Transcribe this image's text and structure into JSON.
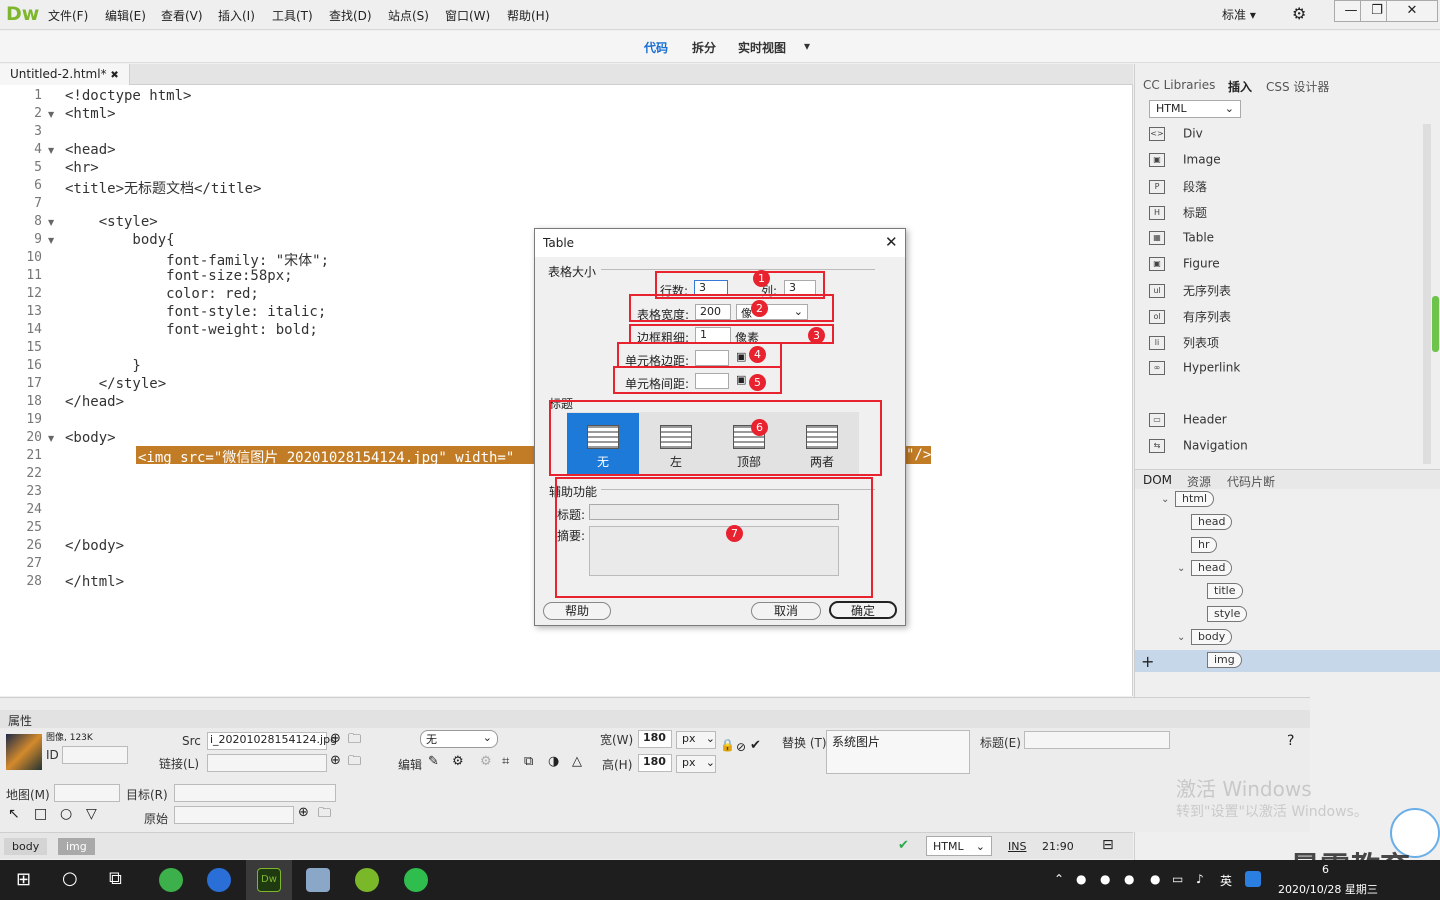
{
  "app": {
    "logo": "Dw",
    "menu": [
      "文件(F)",
      "编辑(E)",
      "查看(V)",
      "插入(I)",
      "工具(T)",
      "查找(D)",
      "站点(S)",
      "窗口(W)",
      "帮助(H)"
    ],
    "layout_select": "标准",
    "window_controls": [
      "—",
      "❐",
      "✕"
    ]
  },
  "viewbar": {
    "code": "代码",
    "split": "拆分",
    "live": "实时视图"
  },
  "document": {
    "tab_label": "Untitled-2.html*",
    "lines": [
      {
        "n": "1",
        "text": "<!doctype html>"
      },
      {
        "n": "2",
        "text": "<html>"
      },
      {
        "n": "3",
        "text": ""
      },
      {
        "n": "4",
        "text": "<head>"
      },
      {
        "n": "5",
        "text": "<hr>"
      },
      {
        "n": "6",
        "text": "<title>无标题文档</title>"
      },
      {
        "n": "7",
        "text": ""
      },
      {
        "n": "8",
        "text": "    <style>"
      },
      {
        "n": "9",
        "text": "        body{"
      },
      {
        "n": "10",
        "text": "            font-family: \"宋体\";"
      },
      {
        "n": "11",
        "text": "            font-size:58px;"
      },
      {
        "n": "12",
        "text": "            color: red;"
      },
      {
        "n": "13",
        "text": "            font-style: italic;"
      },
      {
        "n": "14",
        "text": "            font-weight: bold;"
      },
      {
        "n": "15",
        "text": ""
      },
      {
        "n": "16",
        "text": "        }"
      },
      {
        "n": "17",
        "text": "    </style>"
      },
      {
        "n": "18",
        "text": "</head>"
      },
      {
        "n": "19",
        "text": ""
      },
      {
        "n": "20",
        "text": "<body>"
      },
      {
        "n": "21",
        "text": ""
      },
      {
        "n": "22",
        "text": ""
      },
      {
        "n": "23",
        "text": ""
      },
      {
        "n": "24",
        "text": ""
      },
      {
        "n": "25",
        "text": ""
      },
      {
        "n": "26",
        "text": "</body>"
      },
      {
        "n": "27",
        "text": ""
      },
      {
        "n": "28",
        "text": "</html>"
      }
    ],
    "highlight_left": "<img src=\"微信图片_20201028154124.jpg\" width=\"",
    "highlight_right": "\"/>"
  },
  "right_panel": {
    "tabs": [
      "CC Libraries",
      "插入",
      "CSS 设计器"
    ],
    "category": "HTML",
    "insert_items": [
      {
        "icon": "div-icon",
        "glyph": "<>",
        "label": "Div"
      },
      {
        "icon": "image-icon",
        "glyph": "▣",
        "label": "Image"
      },
      {
        "icon": "paragraph-icon",
        "glyph": "P",
        "label": "段落"
      },
      {
        "icon": "heading-icon",
        "glyph": "H",
        "label": "标题"
      },
      {
        "icon": "table-icon",
        "glyph": "▦",
        "label": "Table"
      },
      {
        "icon": "figure-icon",
        "glyph": "▣",
        "label": "Figure"
      },
      {
        "icon": "ul-icon",
        "glyph": "ul",
        "label": "无序列表"
      },
      {
        "icon": "ol-icon",
        "glyph": "ol",
        "label": "有序列表"
      },
      {
        "icon": "li-icon",
        "glyph": "li",
        "label": "列表项"
      },
      {
        "icon": "hyperlink-icon",
        "glyph": "∞",
        "label": "Hyperlink"
      },
      {
        "icon": "header-icon",
        "glyph": "▭",
        "label": "Header"
      },
      {
        "icon": "navigation-icon",
        "glyph": "⇆",
        "label": "Navigation"
      }
    ],
    "dom_tabs": [
      "DOM",
      "资源",
      "代码片断"
    ],
    "dom_nodes": [
      "html",
      "head",
      "hr",
      "head",
      "title",
      "style",
      "body",
      "img"
    ]
  },
  "properties": {
    "title": "属性",
    "image_info": "图像, 123K",
    "id_label": "ID",
    "src_label": "Src",
    "src_value": "i_20201028154124.jpg",
    "link_label": "链接(L)",
    "class_value": "无",
    "edit_label": "编辑",
    "width_label": "宽(W)",
    "width_value": "180",
    "height_label": "高(H)",
    "height_value": "180",
    "unit": "px",
    "alt_label": "替换 (T)",
    "alt_value": "系统图片",
    "title_label": "标题(E)",
    "map_label": "地图(M)",
    "target_label": "目标(R)",
    "original_label": "原始"
  },
  "status": {
    "crumbs": [
      "body",
      "img"
    ],
    "lang": "HTML",
    "mode": "INS",
    "position": "21:90"
  },
  "dialog": {
    "title": "Table",
    "section_size": "表格大小",
    "rows_label": "行数:",
    "rows_value": "3",
    "cols_label": "列:",
    "cols_value": "3",
    "width_label": "表格宽度:",
    "width_value": "200",
    "width_unit": "像",
    "border_label": "边框粗细:",
    "border_value": "1",
    "border_unit": "像素",
    "padding_label": "单元格边距:",
    "spacing_label": "单元格间距:",
    "section_header": "标题",
    "header_options": [
      "无",
      "左",
      "顶部",
      "两者"
    ],
    "section_access": "辅助功能",
    "caption_label": "标题:",
    "summary_label": "摘要:",
    "help_btn": "帮助",
    "cancel_btn": "取消",
    "ok_btn": "确定",
    "markers": [
      "1",
      "2",
      "3",
      "4",
      "5",
      "6",
      "7"
    ]
  },
  "watermark": {
    "line1": "激活 Windows",
    "line2": "转到\"设置\"以激活 Windows。",
    "brand": "最需教育"
  },
  "taskbar": {
    "ime": "英",
    "time": "6",
    "date": "2020/10/28 星期三"
  }
}
